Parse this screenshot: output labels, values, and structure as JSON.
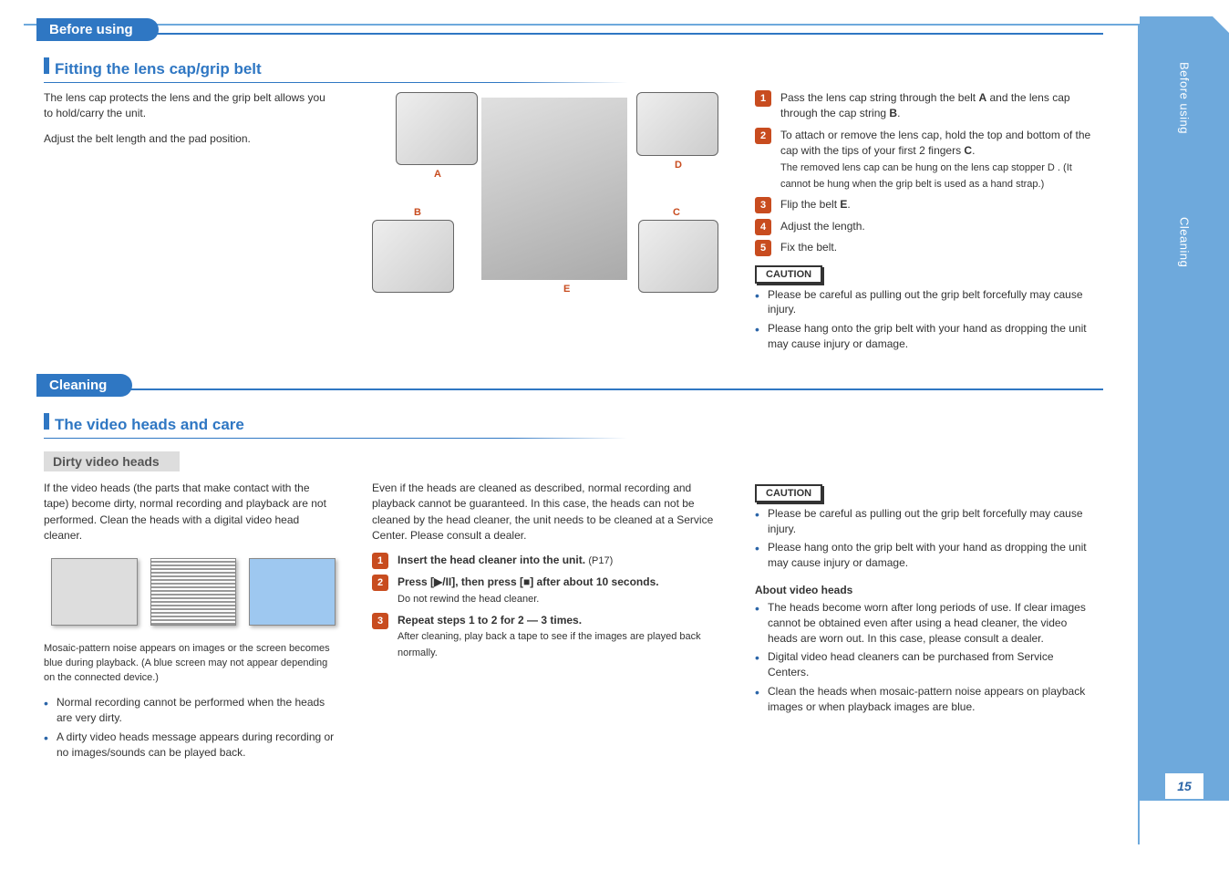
{
  "sidebar": {
    "label1": "Before using",
    "label2": "Cleaning",
    "page_number": "15"
  },
  "section1": {
    "tab": "Before using",
    "heading": "Fitting the lens cap/grip belt",
    "left_para1": "The lens cap protects the lens and the grip belt allows you to hold/carry the unit.",
    "left_para2": "Adjust the belt length and the pad position.",
    "callouts": {
      "a": "A",
      "b": "B",
      "c": "C",
      "d": "D",
      "e": "E"
    },
    "steps": [
      {
        "text": "Pass the lens cap string through the belt  A  and the lens cap through the cap string  B ."
      },
      {
        "text": "To attach or remove the lens cap, hold the top and bottom of the cap with the tips of your first 2 fingers  C .",
        "note": "The removed lens cap can be hung on the lens cap stopper  D . (It cannot be hung when the grip belt is used as a hand strap.)"
      },
      {
        "text": "Flip the belt  E ."
      },
      {
        "text": "Adjust the length."
      },
      {
        "text": "Fix the belt."
      }
    ],
    "caution_label": "CAUTION",
    "caution_bullets": [
      "Please be careful as pulling out the grip belt forcefully may cause injury.",
      "Please hang onto the grip belt with your hand as dropping the unit may cause injury or damage."
    ]
  },
  "section2": {
    "tab": "Cleaning",
    "heading": "The video heads and care",
    "sub": "Dirty video heads",
    "left_para1": "If the video heads (the parts that make contact with the tape) become dirty, normal recording and playback are not performed. Clean the heads with a digital video head cleaner.",
    "left_para2": "Even if the heads are cleaned as described, normal recording and playback cannot be guaranteed. In this case, the heads can not be cleaned by the head cleaner, the unit needs to be cleaned at a Service Center. Please consult a dealer.",
    "example_caption": "Mosaic-pattern noise appears on images or the screen becomes blue during playback. (A blue screen may not appear depending on the connected device.)",
    "bullets": [
      "Normal recording cannot be performed when the heads are very dirty.",
      "A dirty video heads message appears during recording or no images/sounds can be played back."
    ],
    "steps": [
      {
        "pre": "Insert the head cleaner into the unit.",
        "hint": "(P17)"
      },
      {
        "pre": "Press [II], then press [■] after about 10 seconds.",
        "note": "Do not rewind the head cleaner."
      },
      {
        "pre": "Repeat steps 1 to 2 for 2 — 3 times.",
        "note": "After cleaning, play back a tape to see if the images are played back normally."
      }
    ],
    "caution_label": "CAUTION",
    "caution_bullets": [
      "Please be careful as pulling out the grip belt forcefully may cause injury.",
      "Please hang onto the grip belt with your hand as dropping the unit may cause injury or damage."
    ],
    "notes_heading": "About video heads",
    "notes": [
      "The heads become worn after long periods of use. If clear images cannot be obtained even after using a head cleaner, the video heads are worn out. In this case, please consult a dealer.",
      "Digital video head cleaners can be purchased from Service Centers.",
      "Clean the heads when mosaic-pattern noise appears on playback images or when playback images are blue."
    ]
  }
}
